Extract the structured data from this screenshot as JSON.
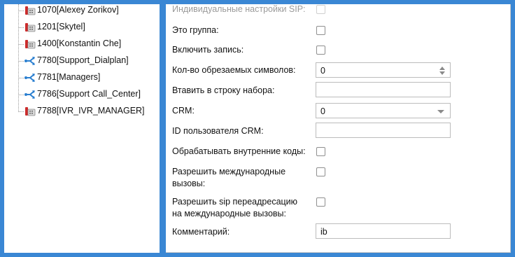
{
  "colors": {
    "frame": "#3a87d4",
    "phone_red": "#cc2b2b",
    "dialplan_blue": "#2a7fd0",
    "disabled_text": "#9a9a9a"
  },
  "tree": {
    "items": [
      {
        "label": "1070[Alexey Zorikov]",
        "icon": "phone-icon"
      },
      {
        "label": "1201[Skytel]",
        "icon": "phone-icon"
      },
      {
        "label": "1400[Konstantin Che]",
        "icon": "phone-icon"
      },
      {
        "label": "7780[Support_Dialplan]",
        "icon": "dialplan-icon"
      },
      {
        "label": "7781[Managers]",
        "icon": "dialplan-icon"
      },
      {
        "label": "7786[Support Call_Center]",
        "icon": "dialplan-icon"
      },
      {
        "label": "7788[IVR_IVR_MANAGER]",
        "icon": "phone-icon"
      }
    ]
  },
  "form": {
    "individual_sip_label": "Индивидуальные настройки SIP:",
    "is_group_label": "Это группа:",
    "enable_recording_label": "Включить запись:",
    "trim_chars_label": "Кол-во обрезаемых символов:",
    "trim_chars_value": "0",
    "insert_dial_label": "Втавить в строку набора:",
    "insert_dial_value": "",
    "crm_label": "CRM:",
    "crm_value": "0",
    "crm_user_id_label": "ID пользователя CRM:",
    "crm_user_id_value": "",
    "process_internal_codes_label": "Обрабатывать внутренние коды:",
    "allow_intl_line1": "Разрешить международные",
    "allow_intl_line2": "вызовы:",
    "allow_sip_redirect_line1": "Разрешить sip переадресацию",
    "allow_sip_redirect_line2": "на международные вызовы:",
    "comment_label": "Комментарий:",
    "comment_value": "ib"
  }
}
